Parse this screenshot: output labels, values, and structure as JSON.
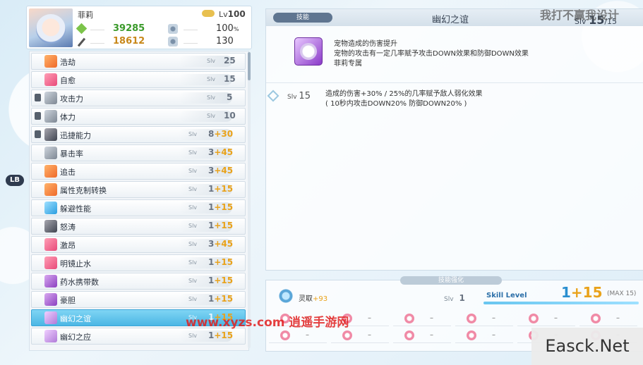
{
  "left_badge": "LB",
  "character": {
    "name": "菲莉",
    "level_label": "Lv",
    "level": "100",
    "attack": "39285",
    "defense": "18612",
    "pct_stat": "100",
    "pct_unit": "%",
    "speed_stat": "130"
  },
  "skill_list": [
    {
      "name": "浩劫",
      "slv_label": "Slv",
      "value": "25",
      "bonus": "",
      "icon": "sword-icon",
      "locked": false
    },
    {
      "name": "自愈",
      "slv_label": "Slv",
      "value": "15",
      "bonus": "",
      "icon": "heal-icon",
      "locked": false
    },
    {
      "name": "攻击力",
      "slv_label": "Slv",
      "value": "5",
      "bonus": "",
      "icon": "attack-icon",
      "locked": true
    },
    {
      "name": "体力",
      "slv_label": "Slv",
      "value": "10",
      "bonus": "",
      "icon": "heart-icon",
      "locked": true
    },
    {
      "name": "迅捷能力",
      "slv_label": "Slv",
      "value": "8",
      "bonus": "+30",
      "icon": "clock-icon",
      "locked": true
    },
    {
      "name": "暴击率",
      "slv_label": "Slv",
      "value": "3",
      "bonus": "+45",
      "icon": "crit-icon",
      "locked": false
    },
    {
      "name": "追击",
      "slv_label": "Slv",
      "value": "3",
      "bonus": "+45",
      "icon": "chase-icon",
      "locked": false
    },
    {
      "name": "属性克制转换",
      "slv_label": "Slv",
      "value": "1",
      "bonus": "+15",
      "icon": "element-icon",
      "locked": false
    },
    {
      "name": "躲避性能",
      "slv_label": "Slv",
      "value": "1",
      "bonus": "+15",
      "icon": "evade-icon",
      "locked": false
    },
    {
      "name": "怒涛",
      "slv_label": "Slv",
      "value": "1",
      "bonus": "+15",
      "icon": "wave-icon",
      "locked": false
    },
    {
      "name": "激昂",
      "slv_label": "Slv",
      "value": "3",
      "bonus": "+45",
      "icon": "star-icon",
      "locked": false
    },
    {
      "name": "明镜止水",
      "slv_label": "Slv",
      "value": "1",
      "bonus": "+15",
      "icon": "mirror-icon",
      "locked": false
    },
    {
      "name": "药水携带数",
      "slv_label": "Slv",
      "value": "1",
      "bonus": "+15",
      "icon": "potion-icon",
      "locked": false
    },
    {
      "name": "豪胆",
      "slv_label": "Slv",
      "value": "1",
      "bonus": "+15",
      "icon": "courage-icon",
      "locked": false
    },
    {
      "name": "幽幻之谊",
      "slv_label": "Slv",
      "value": "1",
      "bonus": "+15",
      "icon": "wolf-icon",
      "locked": false,
      "selected": true
    },
    {
      "name": "幽幻之应",
      "slv_label": "Slv",
      "value": "1",
      "bonus": "+15",
      "icon": "wolf-icon",
      "locked": false
    }
  ],
  "detail": {
    "tab_label": "技能",
    "title": "幽幻之谊",
    "slv_label": "Slv",
    "slv_value": "15",
    "slv_max": "15",
    "description": [
      "宠物造成的伤害提升",
      "宠物的攻击有一定几率赋予攻击DOWN效果和防御DOWN效果",
      "菲莉专属"
    ],
    "effect": {
      "slv_label": "Slv",
      "slv_value": "15",
      "lines": [
        "造成的伤害+30% / 25%的几率赋予敌人弱化效果",
        "( 10秒内攻击DOWN20% 防御DOWN20% )"
      ]
    }
  },
  "levelup": {
    "title": "技能强化",
    "material_name": "灵取",
    "material_bonus": "+93",
    "slv_label": "Slv",
    "slv_value": "1",
    "skill_level_label": "Skill Level",
    "level_base": "1",
    "level_bonus": "+15",
    "max_label": "MAX 15",
    "material_slots": [
      "–",
      "–",
      "–",
      "–",
      "–",
      "–",
      "–",
      "–",
      "–",
      "–",
      "–",
      "–"
    ]
  },
  "watermarks": {
    "top_right": "我打不赢我设计",
    "middle": "www.xyzs.com 逍遥手游网",
    "bottom_right": "Easck.Net"
  }
}
